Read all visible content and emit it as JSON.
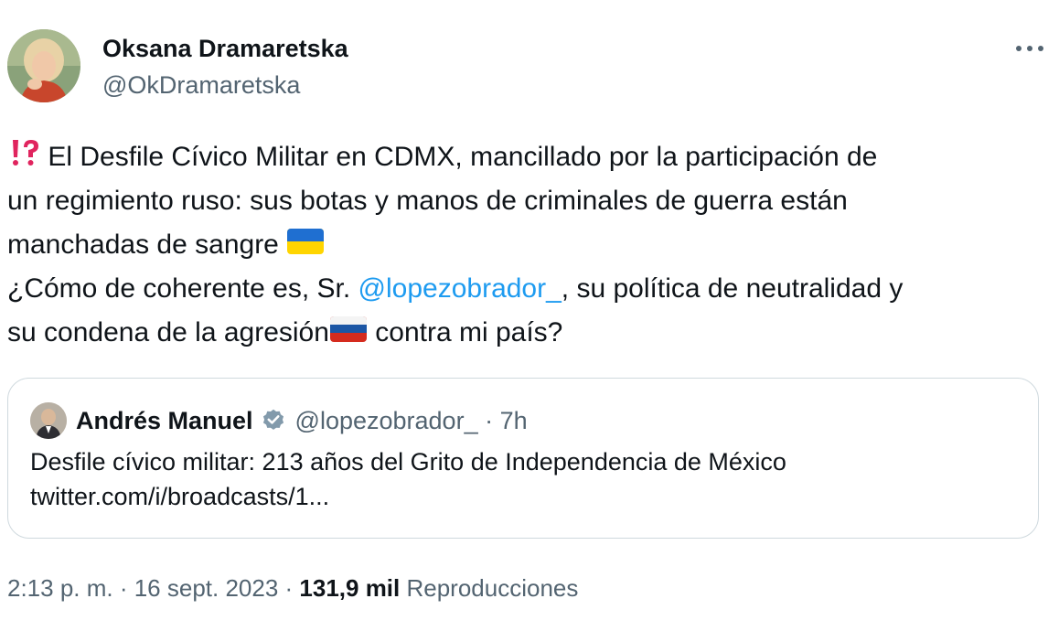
{
  "author": {
    "name": "Oksana Dramaretska",
    "handle": "@OkDramaretska"
  },
  "menu": {
    "more_icon": "more-horizontal-icon"
  },
  "tweet": {
    "emoji_lead": "⁉️",
    "line1": "El Desfile Cívico Militar en CDMX, mancillado por la participación de",
    "line2": "un regimiento ruso: sus botas y manos de criminales de guerra están",
    "line3": "manchadas de sangre",
    "line4_pre": "¿Cómo de coherente es, Sr. ",
    "mention": "@lopezobrador_",
    "line4_post": ", su política de neutralidad y",
    "line5_pre": "su condena de la agresión",
    "line5_post": " contra mi país?",
    "flag_ukraine": "ukraine-flag-icon",
    "flag_russia": "russia-flag-icon"
  },
  "quote": {
    "name": "Andrés Manuel",
    "verified_icon": "verified-badge-icon",
    "handle_time": "@lopezobrador_ · 7h",
    "text_line1": "Desfile cívico militar: 213 años del Grito de Independencia de México",
    "text_line2": "twitter.com/i/broadcasts/1..."
  },
  "meta": {
    "time_date": "2:13 p. m. · 16 sept. 2023 · ",
    "views_count": "131,9 mil",
    "views_label": " Reproducciones"
  },
  "colors": {
    "text": "#0f1419",
    "secondary": "#536471",
    "link": "#1d9bf0",
    "border": "#cfd9de",
    "verified": "#829aab"
  }
}
